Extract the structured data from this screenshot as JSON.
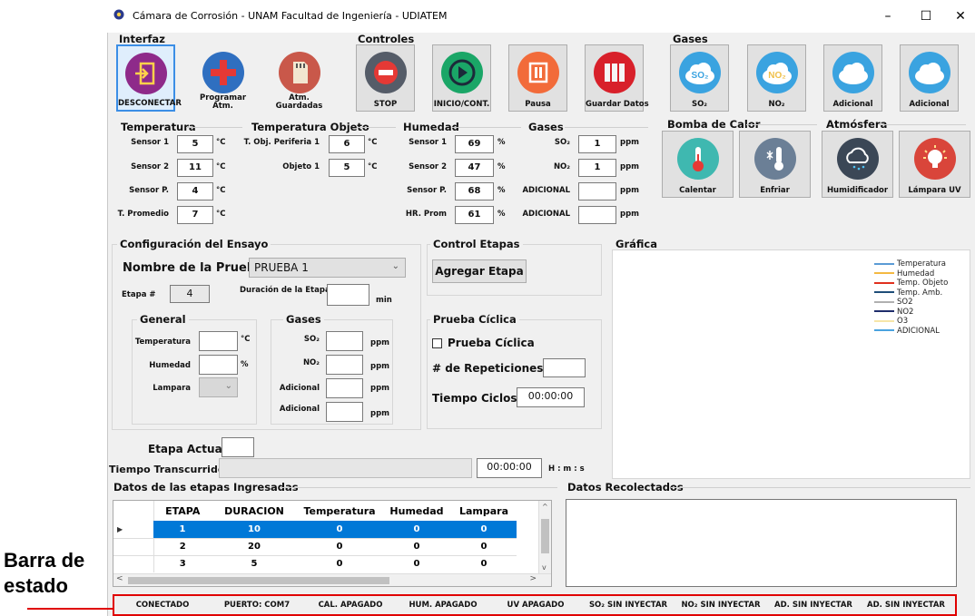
{
  "window": {
    "title": "Cámara de Corrosión - UNAM Facultad de Ingeniería - UDIATEM",
    "minimize": "–",
    "maximize": "☐",
    "close": "✕"
  },
  "side_label": "Barra de estado",
  "toolbar": {
    "interfaz": {
      "title": "Interfaz",
      "buttons": [
        "DESCONECTAR",
        "Programar Atm.",
        "Atm. Guardadas"
      ]
    },
    "controles": {
      "title": "Controles",
      "buttons": [
        "STOP",
        "INICIO/CONT.",
        "Pausa",
        "Guardar Datos"
      ]
    },
    "gases": {
      "title": "Gases",
      "buttons": [
        "SO₂",
        "NO₂",
        "Adicional",
        "Adicional"
      ],
      "icon_texts": [
        "SO₂",
        "NO₂"
      ]
    }
  },
  "temperatura": {
    "title": "Temperatura",
    "rows": [
      {
        "label": "Sensor 1",
        "value": "5",
        "unit": "°C"
      },
      {
        "label": "Sensor 2",
        "value": "11",
        "unit": "°C"
      },
      {
        "label": "Sensor P.",
        "value": "4",
        "unit": "°C"
      },
      {
        "label": "T. Promedio",
        "value": "7",
        "unit": "°C"
      }
    ]
  },
  "temp_objeto": {
    "title": "Temperatura Objeto",
    "rows": [
      {
        "label": "T. Obj. Periferia 1",
        "value": "6",
        "unit": "°C"
      },
      {
        "label": "Objeto 1",
        "value": "5",
        "unit": "°C"
      }
    ]
  },
  "humedad": {
    "title": "Humedad",
    "rows": [
      {
        "label": "Sensor 1",
        "value": "69",
        "unit": "%"
      },
      {
        "label": "Sensor 2",
        "value": "47",
        "unit": "%"
      },
      {
        "label": "Sensor P.",
        "value": "68",
        "unit": "%"
      },
      {
        "label": "HR. Prom",
        "value": "61",
        "unit": "%"
      }
    ]
  },
  "gases_read": {
    "title": "Gases",
    "rows": [
      {
        "label": "SO₂",
        "value": "1",
        "unit": "ppm"
      },
      {
        "label": "NO₂",
        "value": "1",
        "unit": "ppm"
      },
      {
        "label": "ADICIONAL",
        "value": "",
        "unit": "ppm"
      },
      {
        "label": "ADICIONAL",
        "value": "",
        "unit": "ppm"
      }
    ]
  },
  "bomba": {
    "title": "Bomba de Calor",
    "buttons": [
      "Calentar",
      "Enfriar"
    ]
  },
  "atmosfera": {
    "title": "Atmósfera",
    "buttons": [
      "Humidificador",
      "Lámpara UV"
    ]
  },
  "config": {
    "title": "Configuración del Ensayo",
    "nombre_label": "Nombre de la Prueba:",
    "nombre_value": "PRUEBA 1",
    "etapa_label": "Etapa #",
    "etapa_value": "4",
    "duracion_label": "Duración de la Etapa",
    "duracion_unit": "min",
    "general": {
      "title": "General",
      "temperatura": "Temperatura",
      "temp_unit": "°C",
      "humedad": "Humedad",
      "hum_unit": "%",
      "lampara": "Lampara"
    },
    "gases": {
      "title": "Gases",
      "rows": [
        {
          "label": "SO₂",
          "unit": "ppm"
        },
        {
          "label": "NO₂",
          "unit": "ppm"
        },
        {
          "label": "Adicional",
          "unit": "ppm"
        },
        {
          "label": "Adicional",
          "unit": "ppm"
        }
      ]
    }
  },
  "control_etapas": {
    "title": "Control Etapas",
    "button": "Agregar Etapa"
  },
  "prueba_ciclica": {
    "title": "Prueba Cíclica",
    "checkbox": "Prueba Cíclica",
    "repeticiones": "# de Repeticiones:",
    "tiempo": "Tiempo Ciclos:",
    "tiempo_value": "00:00:00"
  },
  "grafica": {
    "title": "Gráfica",
    "legend": [
      {
        "name": "Temperatura",
        "color": "#5b9bd5"
      },
      {
        "name": "Humedad",
        "color": "#f4b942"
      },
      {
        "name": "Temp. Objeto",
        "color": "#e0301e"
      },
      {
        "name": "Temp. Amb.",
        "color": "#1f4e79"
      },
      {
        "name": "SO2",
        "color": "#b0b0b0"
      },
      {
        "name": "NO2",
        "color": "#1f2d6b"
      },
      {
        "name": "O3",
        "color": "#f6e6a8"
      },
      {
        "name": "ADICIONAL",
        "color": "#4aa3df"
      }
    ]
  },
  "etapa_actual": {
    "label": "Etapa Actual",
    "value": ""
  },
  "tiempo_transcurrido": {
    "label": "Tiempo Transcurrido",
    "value": "00:00:00",
    "unit": "H : m : s"
  },
  "datos_etapas": {
    "title": "Datos de las etapas Ingresadas",
    "columns": [
      "ETAPA",
      "DURACION",
      "Temperatura",
      "Humedad",
      "Lampara"
    ],
    "rows": [
      [
        "1",
        "10",
        "0",
        "0",
        "0"
      ],
      [
        "2",
        "20",
        "0",
        "0",
        "0"
      ],
      [
        "3",
        "5",
        "0",
        "0",
        "0"
      ]
    ]
  },
  "datos_recolectados": {
    "title": "Datos Recolectados"
  },
  "status_bar": [
    "CONECTADO",
    "PUERTO: COM7",
    "CAL. APAGADO",
    "HUM. APAGADO",
    "UV APAGADO",
    "SO₂ SIN INYECTAR",
    "NO₂ SIN INYECTAR",
    "AD. SIN INYECTAR",
    "AD. SIN INYECTAR"
  ],
  "colors": {
    "accent_select": "#0078d7",
    "status_border": "#e00000"
  }
}
